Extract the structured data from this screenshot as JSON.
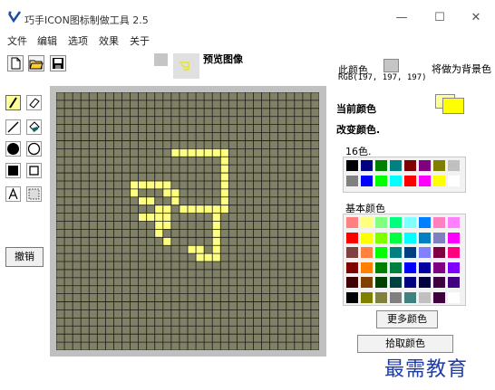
{
  "window": {
    "title": "巧手ICON图标制做工具 2.5",
    "minimize_glyph": "—",
    "maximize_glyph": "☐",
    "close_glyph": "✕"
  },
  "menu": [
    "文件",
    "编辑",
    "选项",
    "效果",
    "关于"
  ],
  "toolbar": {
    "icons": [
      "new-file-icon",
      "open-folder-icon",
      "save-disk-icon"
    ]
  },
  "tools": [
    "pencil-icon",
    "eraser-icon",
    "line-icon",
    "fill-bucket-icon",
    "filled-circle-icon",
    "circle-outline-icon",
    "filled-rect-icon",
    "rect-outline-icon",
    "text-icon",
    "select-icon"
  ],
  "preview": {
    "label": "预览图像"
  },
  "undo": {
    "label": "撤销"
  },
  "color_info": {
    "this_color_label": "此颜色",
    "rgb_text": "RGB(197, 197, 197)",
    "set_bg_label": "将做为背景色",
    "current_color_label": "当前颜色",
    "change_color_label": "改变颜色.",
    "current_color": "#ffff00"
  },
  "palette16": {
    "label": "16色.",
    "colors": [
      "#000000",
      "#000080",
      "#008000",
      "#008080",
      "#800000",
      "#800080",
      "#808000",
      "#c0c0c0",
      "#808080",
      "#0000ff",
      "#00ff00",
      "#00ffff",
      "#ff0000",
      "#ff00ff",
      "#ffff00",
      "#ffffff"
    ]
  },
  "basic_palette": {
    "label": "基本颜色",
    "colors": [
      "#ff8080",
      "#ffff80",
      "#80ff80",
      "#00ff80",
      "#80ffff",
      "#0080ff",
      "#ff80c0",
      "#ff80ff",
      "#ff0000",
      "#ffff00",
      "#80ff00",
      "#00ff40",
      "#00ffff",
      "#0080c0",
      "#8080c0",
      "#ff00ff",
      "#804040",
      "#ff8040",
      "#00ff00",
      "#008080",
      "#004080",
      "#8080ff",
      "#800040",
      "#ff0080",
      "#800000",
      "#ff8000",
      "#008000",
      "#008040",
      "#0000ff",
      "#0000a0",
      "#800080",
      "#8000ff",
      "#400000",
      "#804000",
      "#004000",
      "#004040",
      "#000080",
      "#000040",
      "#400040",
      "#400080",
      "#000000",
      "#808000",
      "#808040",
      "#808080",
      "#408080",
      "#c0c0c0",
      "#400040",
      "#ffffff"
    ]
  },
  "buttons": {
    "more_colors": "更多颜色",
    "pick_color": "拾取颜色"
  },
  "canvas": {
    "grid_color": "#1a1a1a",
    "bg_color": "#808066",
    "fill_color": "#ffff80"
  },
  "watermark": "最需教育"
}
